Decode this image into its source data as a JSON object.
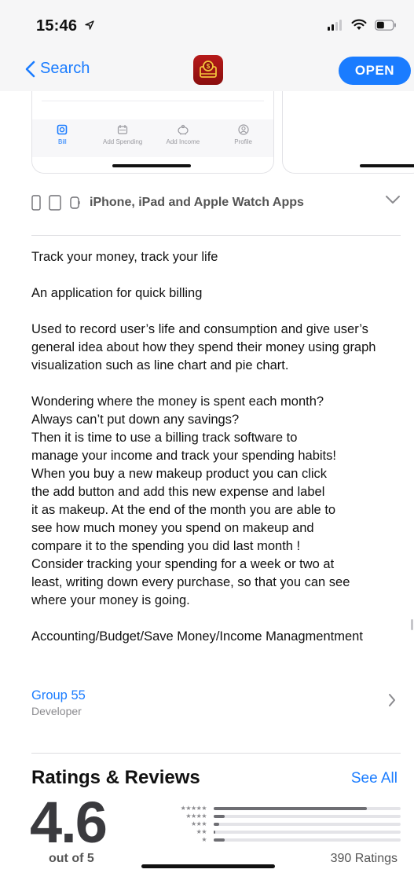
{
  "status": {
    "time": "15:46"
  },
  "nav": {
    "back_label": "Search",
    "open_label": "OPEN"
  },
  "screenshot_tabs": [
    {
      "label": "Bill",
      "active": true
    },
    {
      "label": "Add Spending",
      "active": false
    },
    {
      "label": "Add Income",
      "active": false
    },
    {
      "label": "Profile",
      "active": false
    }
  ],
  "devices": {
    "label": "iPhone, iPad and Apple Watch Apps"
  },
  "description": {
    "p1": "Track your money, track your life",
    "p2": "An application for quick billing",
    "p3": "Used to record user’s life and consumption and give user’s general idea about how they spend their money using graph visualization such as line chart and pie chart.",
    "p4_lines": [
      "Wondering where the money is spent each month?",
      "Always can’t put down any savings?",
      "Then it is time to use a billing track software to",
      "manage your income and track your spending habits!",
      "When you buy a new makeup product you can click",
      "the add button and add this new expense and label",
      "it as makeup. At the end of the month you are able to",
      "see how much money you spend on makeup and",
      "compare it to the spending you did last month !",
      "Consider tracking your spending for a week or two at",
      "least, writing down every purchase, so that you can see",
      "where your money is going."
    ],
    "p5": "Accounting/Budget/Save Money/Income Managmentment"
  },
  "developer": {
    "name": "Group 55",
    "role": "Developer"
  },
  "ratings": {
    "title": "Ratings & Reviews",
    "see_all": "See All",
    "average": "4.6",
    "out_of": "out of 5",
    "count_label": "390 Ratings",
    "distribution": [
      {
        "stars": "★★★★★",
        "fraction": 0.82
      },
      {
        "stars": "★★★★",
        "fraction": 0.06
      },
      {
        "stars": "★★★",
        "fraction": 0.03
      },
      {
        "stars": "★★",
        "fraction": 0.01
      },
      {
        "stars": "★",
        "fraction": 0.06
      }
    ]
  },
  "colors": {
    "accent": "#1a7cff",
    "app_icon": "#a01414"
  }
}
